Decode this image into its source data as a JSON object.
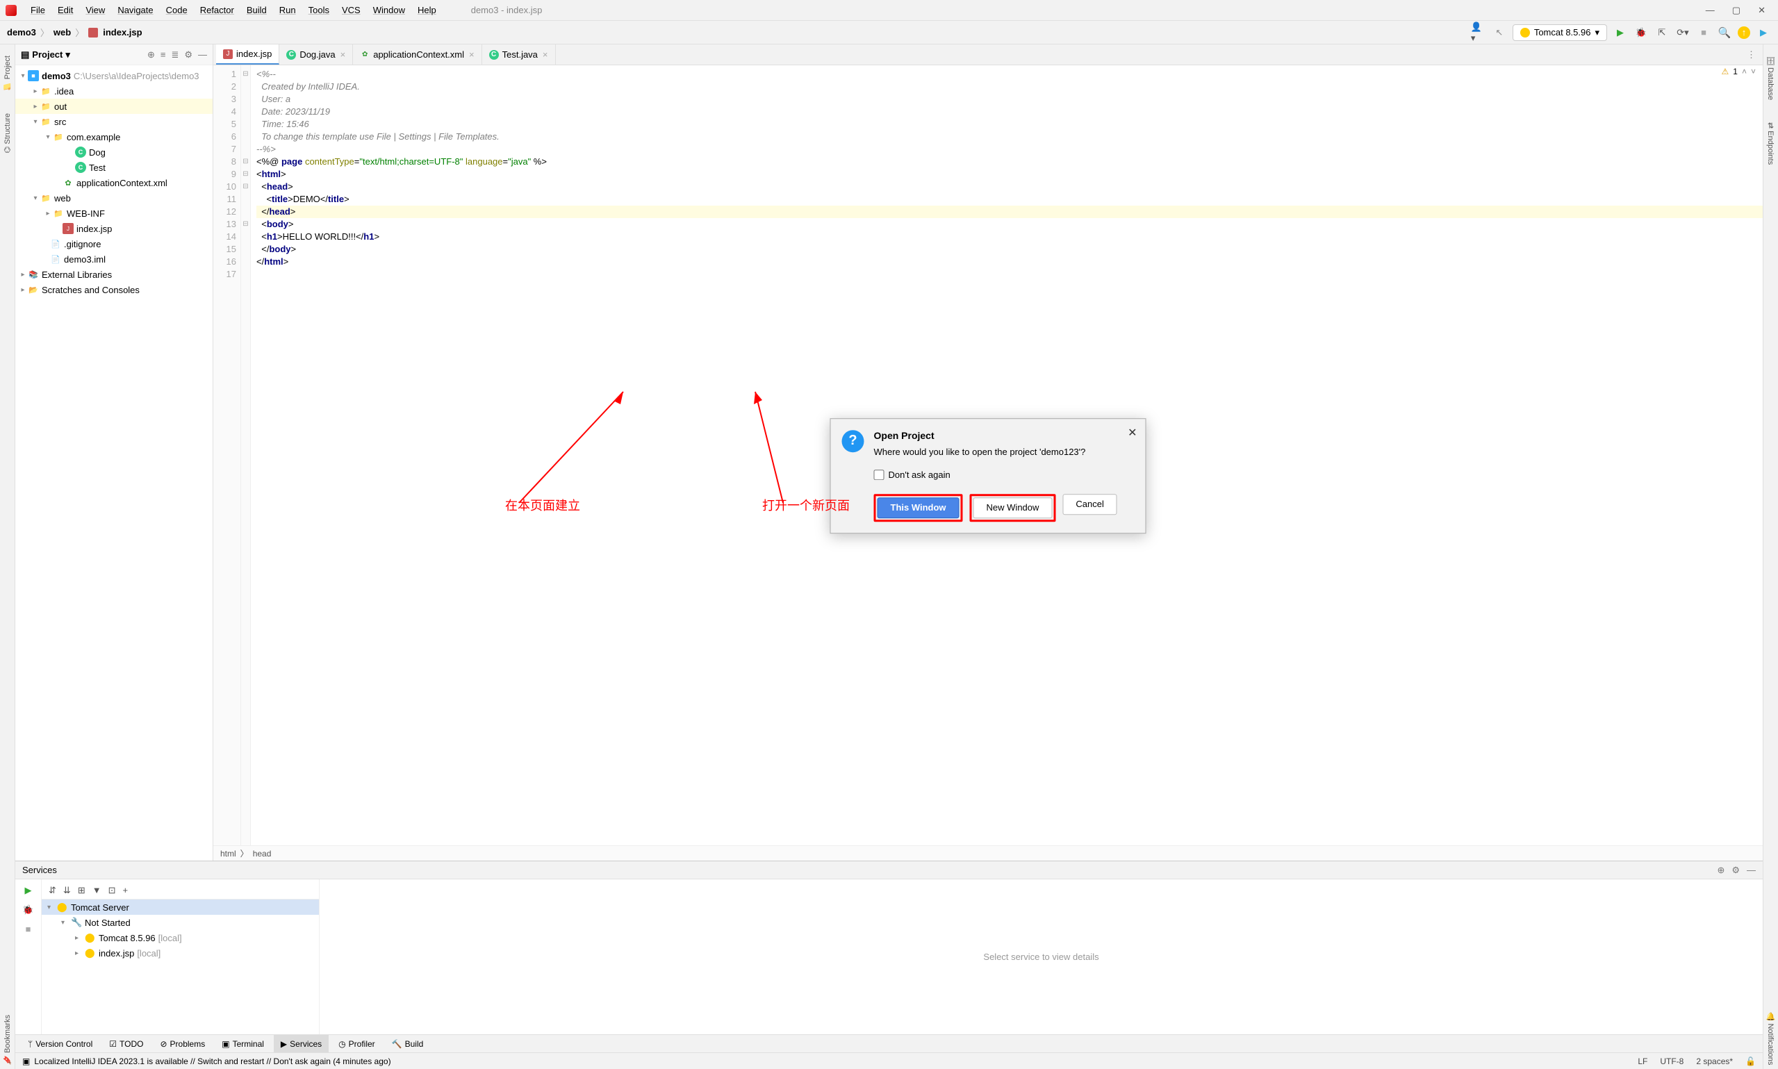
{
  "window": {
    "title": "demo3 - index.jsp",
    "menus": [
      "File",
      "Edit",
      "View",
      "Navigate",
      "Code",
      "Refactor",
      "Build",
      "Run",
      "Tools",
      "VCS",
      "Window",
      "Help"
    ]
  },
  "breadcrumb": {
    "project": "demo3",
    "folder": "web",
    "file": "index.jsp"
  },
  "runconfig": {
    "label": "Tomcat 8.5.96"
  },
  "projectTool": {
    "title": "Project",
    "tree": {
      "root": {
        "name": "demo3",
        "path": "C:\\Users\\a\\IdeaProjects\\demo3"
      },
      "idea": ".idea",
      "out": "out",
      "src": "src",
      "pkg": "com.example",
      "c1": "Dog",
      "c2": "Test",
      "appctx": "applicationContext.xml",
      "web": "web",
      "webinf": "WEB-INF",
      "indexjsp": "index.jsp",
      "gitignore": ".gitignore",
      "iml": "demo3.iml",
      "extlib": "External Libraries",
      "scratch": "Scratches and Consoles"
    }
  },
  "tabs": [
    {
      "label": "index.jsp",
      "type": "jsp",
      "active": true
    },
    {
      "label": "Dog.java",
      "type": "class",
      "active": false
    },
    {
      "label": "applicationContext.xml",
      "type": "xml",
      "active": false
    },
    {
      "label": "Test.java",
      "type": "class",
      "active": false
    }
  ],
  "inspections": {
    "warn_count": "1"
  },
  "code": {
    "lines": [
      "<%--",
      "  Created by IntelliJ IDEA.",
      "  User: a",
      "  Date: 2023/11/19",
      "  Time: 15:46",
      "  To change this template use File | Settings | File Templates.",
      "--%>",
      "<%@ page contentType=\"text/html;charset=UTF-8\" language=\"java\" %>",
      "<html>",
      "  <head>",
      "    <title>DEMO</title>",
      "  </head>",
      "  <body>",
      "  <h1>HELLO WORLD!!!</h1>",
      "  </body>",
      "</html>",
      ""
    ],
    "highlight_line": 12
  },
  "breadcrumb_bottom": {
    "p0": "html",
    "p1": "head"
  },
  "services": {
    "title": "Services",
    "root": "Tomcat Server",
    "notstarted": "Not Started",
    "item1": "Tomcat 8.5.96",
    "item1_hint": "[local]",
    "item2": "index.jsp",
    "item2_hint": "[local]",
    "placeholder": "Select service to view details"
  },
  "bottomTabs": {
    "vc": "Version Control",
    "todo": "TODO",
    "problems": "Problems",
    "terminal": "Terminal",
    "services": "Services",
    "profiler": "Profiler",
    "build": "Build"
  },
  "status": {
    "msg": "Localized IntelliJ IDEA 2023.1 is available // Switch and restart // Don't ask again (4 minutes ago)",
    "lf": "LF",
    "enc": "UTF-8",
    "indent": "2 spaces*"
  },
  "dialog": {
    "title": "Open Project",
    "message": "Where would you like to open the project 'demo123'?",
    "dont_ask": "Don't ask again",
    "btn_this": "This Window",
    "btn_new": "New Window",
    "btn_cancel": "Cancel"
  },
  "sideTabs": {
    "project": "Project",
    "structure": "Structure",
    "bookmarks": "Bookmarks",
    "database": "Database",
    "endpoints": "Endpoints",
    "notifications": "Notifications"
  },
  "annotations": {
    "left": "在本页面建立",
    "right": "打开一个新页面"
  }
}
